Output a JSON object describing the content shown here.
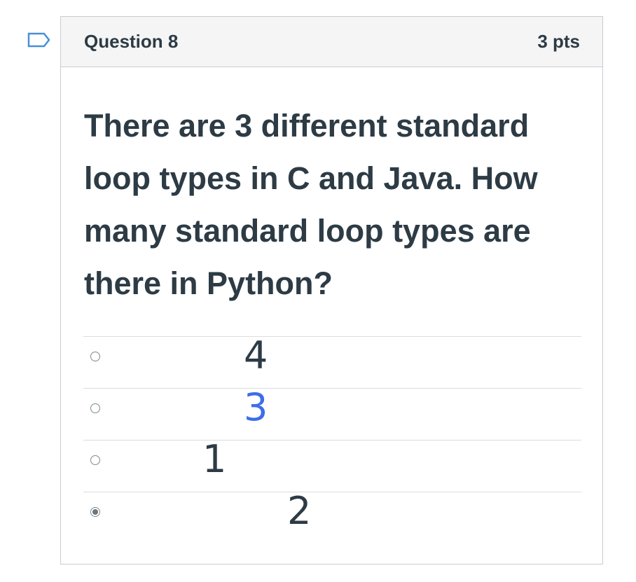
{
  "question": {
    "title": "Question 8",
    "points": "3 pts",
    "text": "There are 3 different standard loop types in C and Java.  How many standard loop types are there in Python?"
  },
  "answers": [
    {
      "label": "4",
      "color": "#2d3b45",
      "selected": false
    },
    {
      "label": "3",
      "color": "#3b6ee8",
      "selected": false
    },
    {
      "label": "1",
      "color": "#2d3b45",
      "selected": false
    },
    {
      "label": "2",
      "color": "#2d3b45",
      "selected": true
    }
  ],
  "colors": {
    "text": "#2d3b45",
    "border": "#c7cdd1",
    "header_bg": "#f5f5f5",
    "accent": "#3b6ee8"
  }
}
